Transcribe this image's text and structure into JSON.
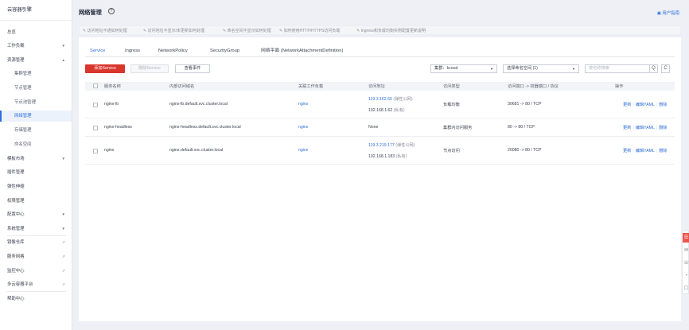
{
  "sidebar": {
    "title": "云容器引擎",
    "items": [
      {
        "label": "总览"
      },
      {
        "label": "工作负载",
        "arrow": "▼"
      },
      {
        "label": "资源管理",
        "arrow": "▲"
      },
      {
        "label": "集群管理"
      },
      {
        "label": "节点管理"
      },
      {
        "label": "节点池管理"
      },
      {
        "label": "网络管理"
      },
      {
        "label": "存储管理"
      },
      {
        "label": "命名空间"
      },
      {
        "label": "模板市场",
        "arrow": "▼"
      },
      {
        "label": "插件管理"
      },
      {
        "label": "弹性伸缩"
      },
      {
        "label": "权限管理"
      },
      {
        "label": "配置中心",
        "arrow": "▼"
      },
      {
        "label": "系统管理",
        "arrow": "▼"
      },
      {
        "label": "镜像仓库",
        "pin": "⇗"
      },
      {
        "label": "服务网格",
        "pin": "⇗"
      },
      {
        "label": "监控中心",
        "pin": "⇗"
      },
      {
        "label": "多云容器平台",
        "pin": "⇗"
      },
      {
        "label": "帮助中心"
      }
    ]
  },
  "header": {
    "title": "网络管理",
    "help_icon": "?",
    "guide_link": "用户指南"
  },
  "tips": [
    "访问地址不通如何处理",
    "访问地址不显示/未更新如何处理",
    "命名空间不显示如何处理",
    "如何使用HTTP/HTTPS访问负载",
    "Ingress和负载均衡实例配置更新说明"
  ],
  "tabs": [
    "Service",
    "Ingress",
    "NetworkPolicy",
    "SecurityGroup",
    "网络平面 (NetworkAttachmentDefinition)"
  ],
  "toolbar": {
    "add_label": "添加Service",
    "delete_label": "删除Service",
    "events_label": "查看事件",
    "cluster_select": "集群：kcoud",
    "namespace_select": "选择命名空间 (1)",
    "search_placeholder": "按名称搜索",
    "search_icon": "Q",
    "refresh_icon": "C"
  },
  "table": {
    "headers": [
      "服务名称",
      "内部访问域名",
      "关联工作负载",
      "访问地址",
      "访问类型",
      "访问端口 -> 容器端口 / 协议",
      "操作"
    ],
    "rows": [
      {
        "name": "nginx-lb",
        "domain": "nginx-lb.default.svc.cluster.local",
        "workload": "nginx",
        "addr1": "119.3.162.66",
        "addr1_note": "(弹性公网)",
        "addr2": "192.168.1.62",
        "addr2_note": "(私有)",
        "type": "负载均衡",
        "ports": "30681 -> 80 / TCP"
      },
      {
        "name": "nginx-headless",
        "domain": "nginx-headless.default.svc.cluster.local",
        "workload": "nginx",
        "addr1": "None",
        "addr1_note": "",
        "addr2": "",
        "addr2_note": "",
        "type": "集群内访问服务",
        "ports": "80 -> 80 / TCP"
      },
      {
        "name": "nginx",
        "domain": "nginx.default.svc.cluster.local",
        "workload": "nginx",
        "addr1": "119.3.219.177",
        "addr1_note": "(弹性公网)",
        "addr2": "192.168.1.183",
        "addr2_note": "(私有)",
        "type": "节点访问",
        "ports": "20080 -> 80 / TCP"
      }
    ],
    "ops": [
      "更新",
      "编辑YAML",
      "删除"
    ]
  },
  "float_bar": [
    "☰",
    "✉",
    "☏",
    "◔",
    "☐"
  ],
  "colors": {
    "accent": "#2f6fd8",
    "primary_button": "#d9362c",
    "float_highlight": "#e8574e"
  }
}
